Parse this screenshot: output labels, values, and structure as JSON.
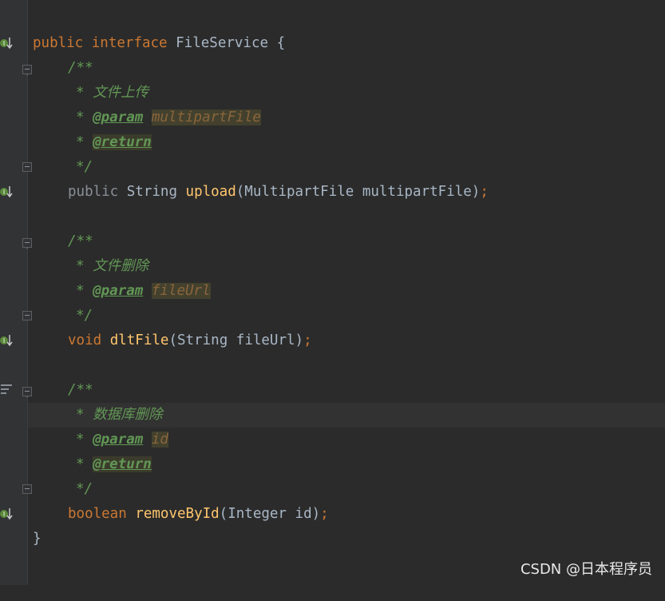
{
  "editor": {
    "l1": {
      "kw1": "public",
      "kw2": "interface",
      "name": "FileService",
      "brace": "{"
    },
    "l2": {
      "text": "/**"
    },
    "l3": {
      "star": "*",
      "text": "文件上传"
    },
    "l4": {
      "star": "*",
      "tag": "@param",
      "pname": "multipartFile"
    },
    "l5": {
      "star": "*",
      "tag": "@return"
    },
    "l6": {
      "text": "*/"
    },
    "l7": {
      "mod": "public",
      "type": "String",
      "fn": "upload",
      "open": "(",
      "ptype": "MultipartFile",
      "pname": "multipartFile",
      "close": ")",
      "semi": ";"
    },
    "l9": {
      "text": "/**"
    },
    "l10": {
      "star": "*",
      "text": "文件删除"
    },
    "l11": {
      "star": "*",
      "tag": "@param",
      "pname": "fileUrl"
    },
    "l12": {
      "text": "*/"
    },
    "l13": {
      "kw": "void",
      "fn": "dltFile",
      "open": "(",
      "ptype": "String",
      "pname": "fileUrl",
      "close": ")",
      "semi": ";"
    },
    "l15": {
      "text": "/**"
    },
    "l16": {
      "star": "*",
      "text": "数据库删除"
    },
    "l17": {
      "star": "*",
      "tag": "@param",
      "pname": "id"
    },
    "l18": {
      "star": "*",
      "tag": "@return"
    },
    "l19": {
      "text": "*/"
    },
    "l20": {
      "kw": "boolean",
      "fn": "removeById",
      "open": "(",
      "ptype": "Integer",
      "pname": "id",
      "close": ")",
      "semi": ";"
    },
    "l21": {
      "brace": "}"
    }
  },
  "watermark": "CSDN @日本程序员",
  "colors": {
    "keyword": "#cc7832",
    "identifier": "#a9b7c6",
    "function": "#ffc66d",
    "doc": "#629755",
    "background": "#2b2b2b",
    "gutter": "#313335"
  },
  "icons": [
    "implementation-gutter-icon",
    "fold-icon",
    "structure-lines-icon"
  ]
}
